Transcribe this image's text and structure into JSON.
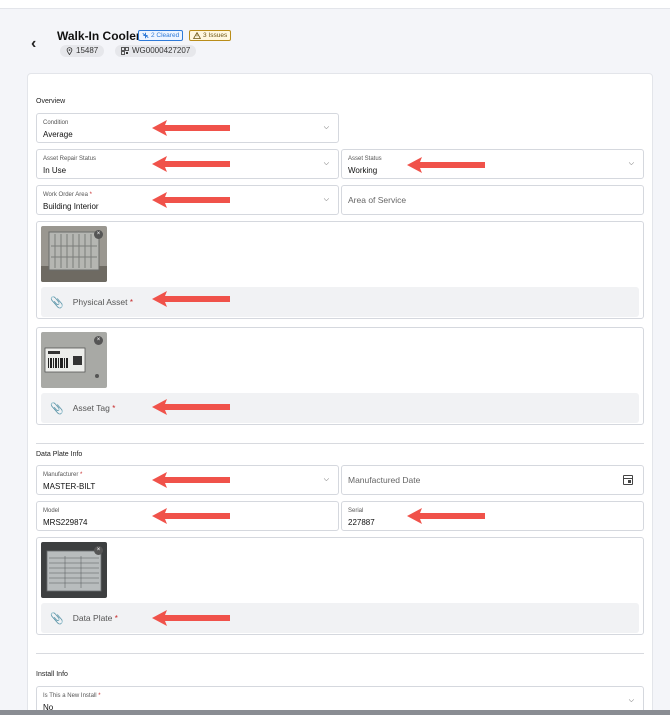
{
  "header": {
    "back_icon": "‹",
    "title": "Walk-In Cooler",
    "badge_cleared": "2 Cleared",
    "badge_issues": "3 Issues",
    "location_id": "15487",
    "work_order_id": "WG0000427207"
  },
  "overview": {
    "section_title": "Overview",
    "condition": {
      "label": "Condition",
      "value": "Average"
    },
    "asset_repair_status": {
      "label": "Asset Repair Status",
      "value": "In Use"
    },
    "asset_status": {
      "label": "Asset Status",
      "value": "Working"
    },
    "work_order_area": {
      "label": "Work Order Area",
      "value": "Building Interior"
    },
    "area_of_service": {
      "placeholder": "Area of Service"
    },
    "physical_asset": {
      "label": "Physical Asset"
    },
    "asset_tag": {
      "label": "Asset Tag"
    }
  },
  "data_plate": {
    "section_title": "Data Plate Info",
    "manufacturer": {
      "label": "Manufacturer",
      "value": "MASTER-BILT"
    },
    "manufactured_date": {
      "placeholder": "Manufactured Date"
    },
    "model": {
      "label": "Model",
      "value": "MRS229874"
    },
    "serial": {
      "label": "Serial",
      "value": "227887"
    },
    "data_plate_photo": {
      "label": "Data Plate"
    }
  },
  "install": {
    "section_title": "Install Info",
    "is_new_install": {
      "label": "Is This a New Install",
      "value": "No"
    }
  },
  "common": {
    "required_mark": "*",
    "remove_icon": "×",
    "paperclip_icon": "⌀"
  },
  "colors": {
    "arrow": "#f0524a",
    "cleared_badge": "#2f7ad8",
    "issues_badge": "#b98d1a",
    "required": "#c62828"
  }
}
